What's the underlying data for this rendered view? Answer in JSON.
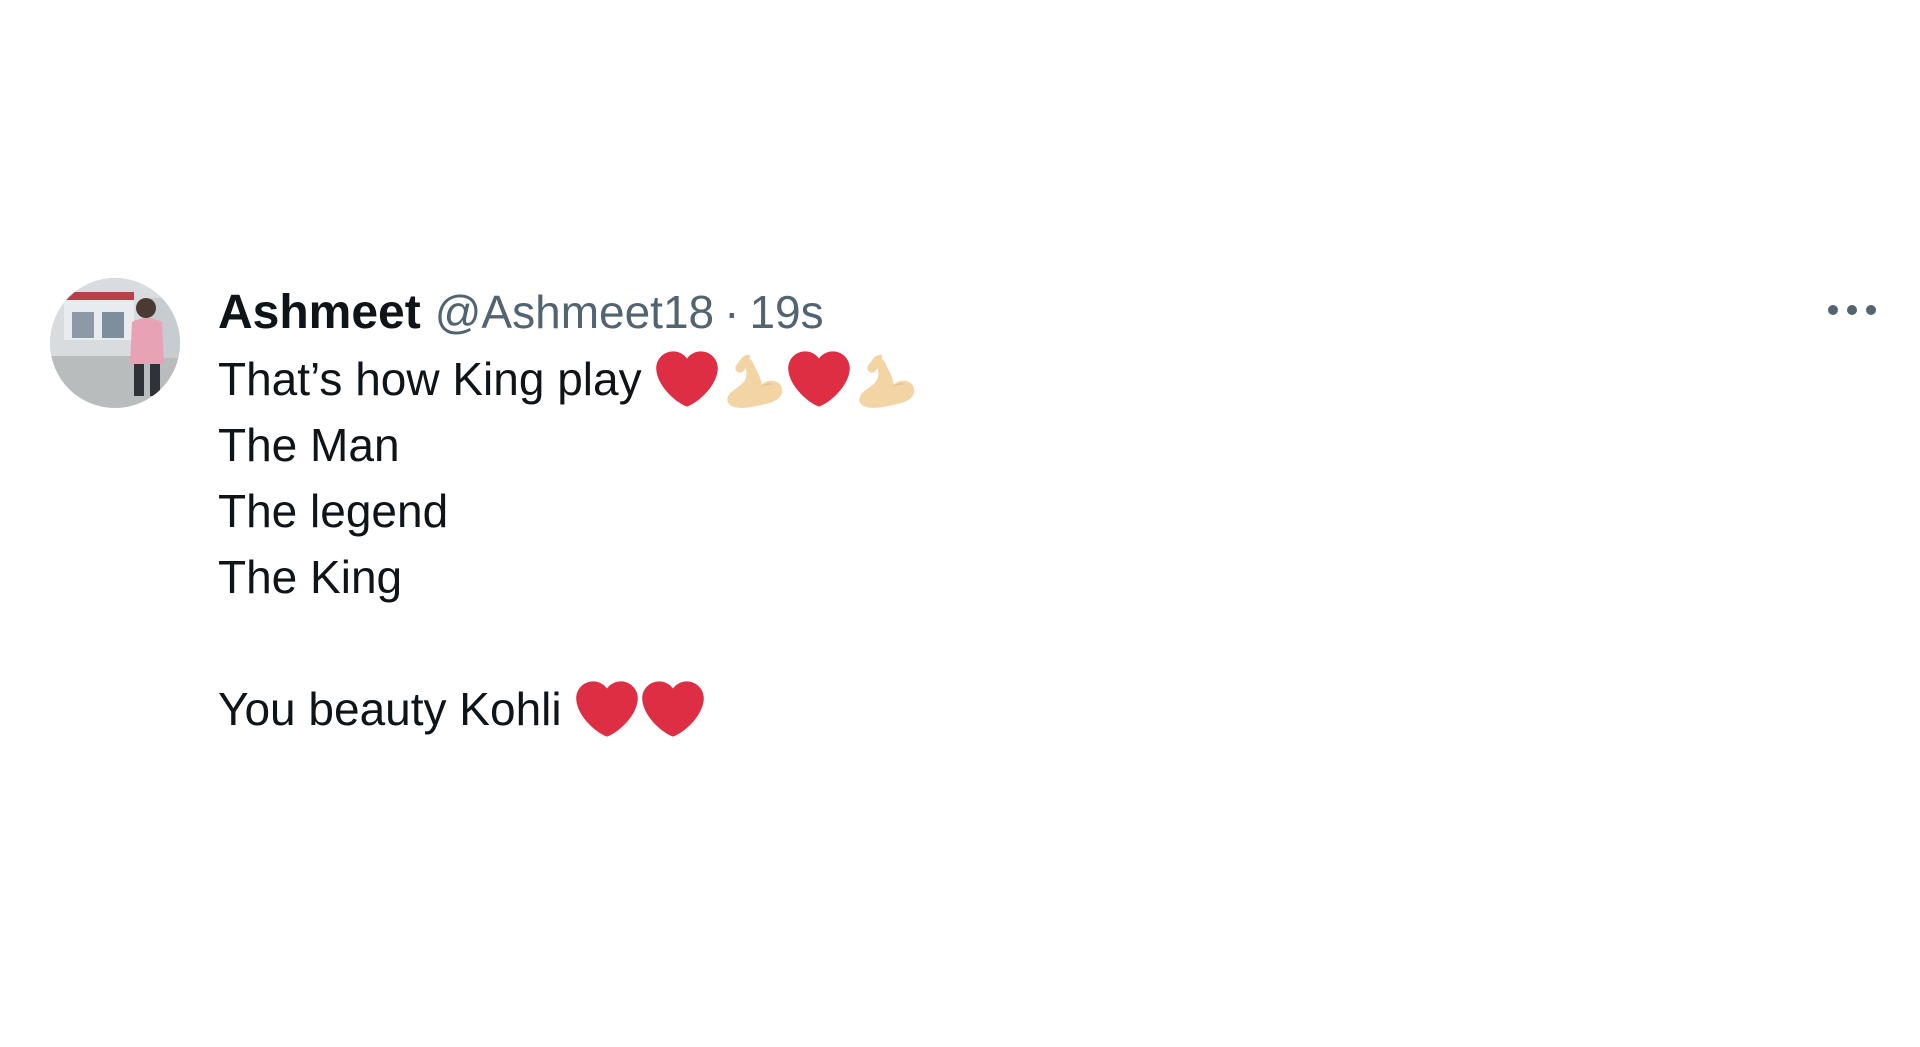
{
  "tweet": {
    "display_name": "Ashmeet",
    "handle": "@Ashmeet18",
    "separator": "·",
    "time": "19s",
    "lines": [
      "That’s how King play",
      "The Man",
      "The legend",
      "The King",
      "",
      "You beauty Kohli"
    ],
    "line1_emojis": [
      "red-heart-icon",
      "flexed-biceps-icon",
      "red-heart-icon",
      "flexed-biceps-icon"
    ],
    "line6_emojis": [
      "red-heart-icon",
      "red-heart-icon"
    ]
  },
  "colors": {
    "text_primary": "#0f1419",
    "text_secondary": "#536471",
    "heart": "#dd2e44",
    "biceps": "#f3d5a5"
  }
}
